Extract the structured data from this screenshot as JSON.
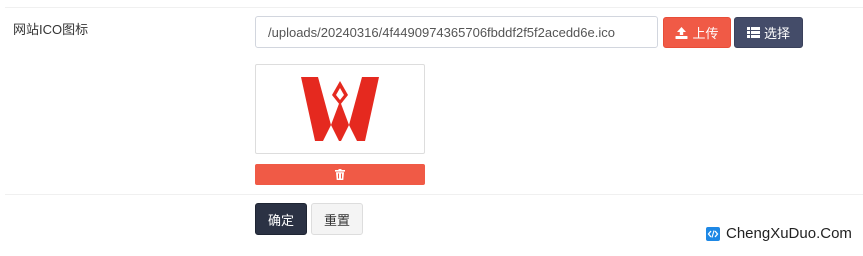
{
  "form": {
    "field_label": "网站ICO图标",
    "path_value": "/uploads/20240316/4f4490974365706fbddf2f5f2acedd6e.ico",
    "upload_label": "上传",
    "choose_label": "选择",
    "confirm_label": "确定",
    "reset_label": "重置"
  },
  "icons": {
    "upload": "upload-icon",
    "choose": "list-icon",
    "delete": "trash-icon",
    "preview": "w-logo",
    "watermark": "code-icon"
  },
  "colors": {
    "danger": "#f05a46",
    "primary": "#444c69",
    "dark": "#2b3244",
    "logo_red": "#e5291f",
    "watermark_icon": "#1e88e5"
  },
  "watermark": {
    "text": "ChengXuDuo.Com"
  }
}
